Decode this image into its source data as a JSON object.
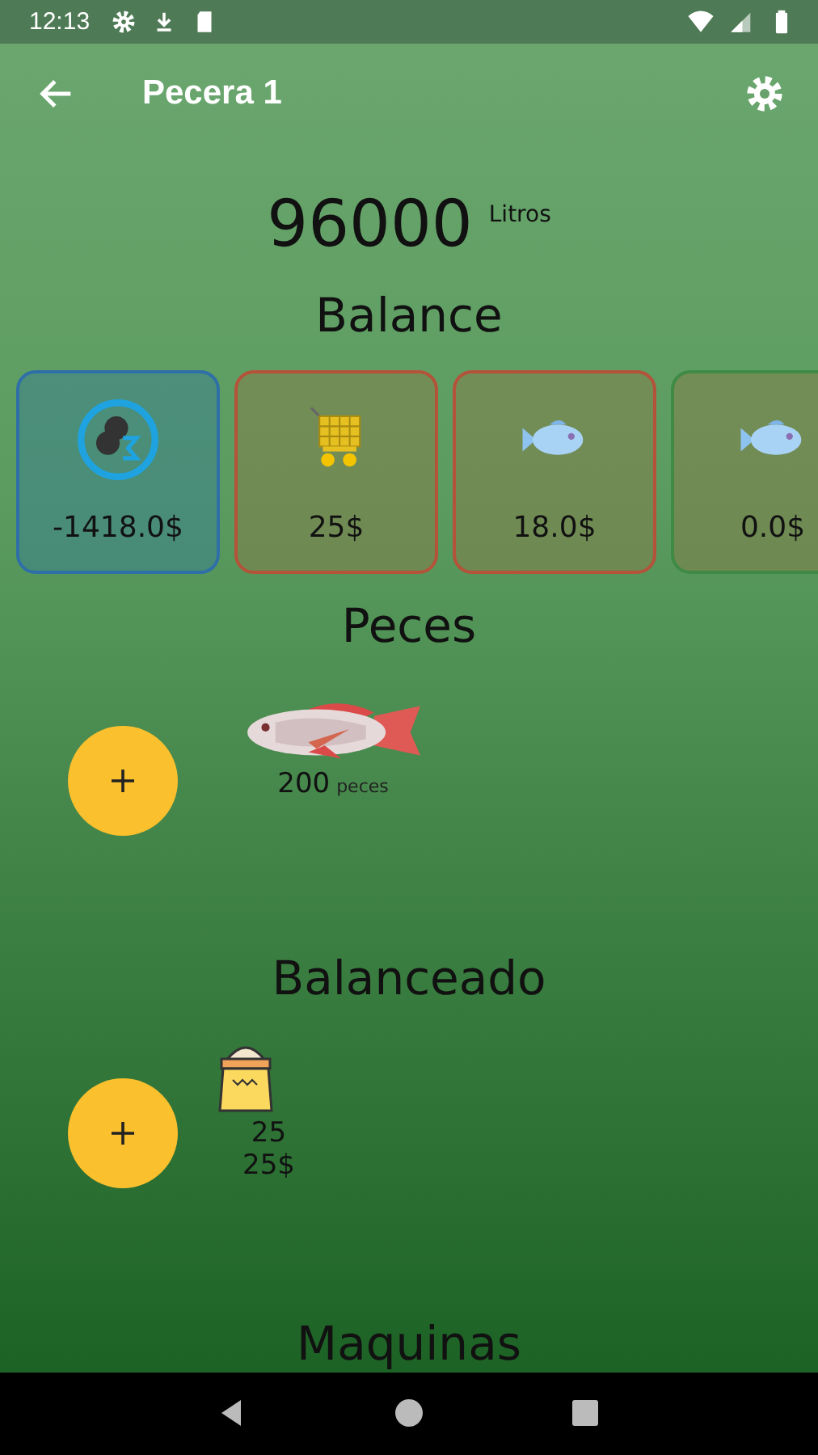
{
  "status_bar": {
    "time": "12:13"
  },
  "app_bar": {
    "title": "Pecera 1"
  },
  "volume": {
    "value": "96000",
    "unit": "Litros"
  },
  "balance": {
    "title": "Balance",
    "cards": [
      {
        "kind": "total",
        "value": "-1418.0$",
        "color": "#2f6fa8"
      },
      {
        "kind": "cart",
        "value": "25$",
        "color": "#b5523a"
      },
      {
        "kind": "fish",
        "value": "18.0$",
        "color": "#b5523a"
      },
      {
        "kind": "fish",
        "value": "0.0$",
        "color": "#3f8a44"
      }
    ]
  },
  "sections": [
    {
      "title": "Peces",
      "item": {
        "kind": "fish",
        "lines": [
          "200"
        ],
        "unit": "peces"
      }
    },
    {
      "title": "Balanceado",
      "item": {
        "kind": "feed",
        "lines": [
          "25",
          "25$"
        ]
      }
    },
    {
      "title": "Maquinas"
    }
  ]
}
